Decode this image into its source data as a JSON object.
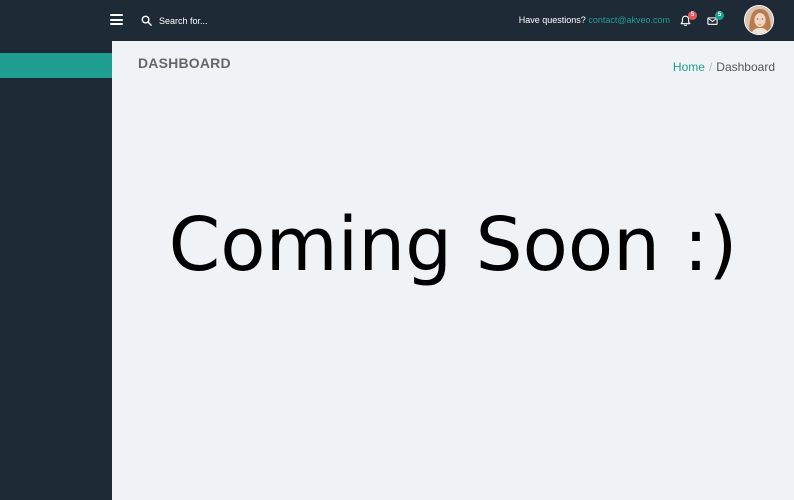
{
  "search": {
    "placeholder": "Search for..."
  },
  "header": {
    "questions_label": "Have questions?",
    "contact_email": "contact@akveo.com",
    "notifications_count": "5",
    "messages_count": "5"
  },
  "page": {
    "title": "DASHBOARD",
    "message": "Coming Soon :)"
  },
  "breadcrumb": {
    "home": "Home",
    "separator": "/",
    "current": "Dashboard"
  },
  "colors": {
    "sidebar_bg": "#1e2b36",
    "accent": "#209e91",
    "content_bg": "#eff3f5",
    "badge_red": "#e85656"
  },
  "icons": [
    "menu-icon",
    "search-icon",
    "bell-icon",
    "mail-icon",
    "avatar"
  ]
}
